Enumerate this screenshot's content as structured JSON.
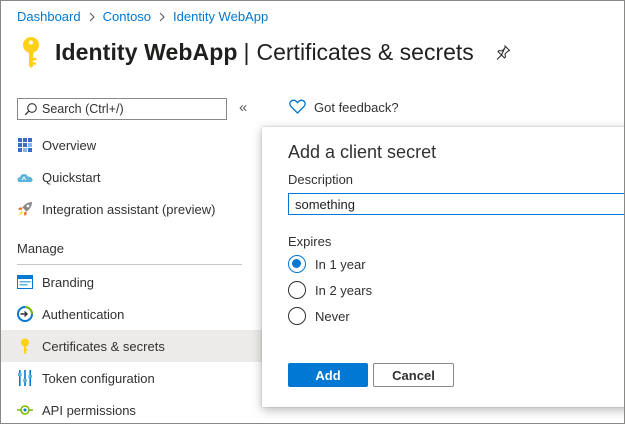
{
  "breadcrumb": {
    "items": [
      "Dashboard",
      "Contoso",
      "Identity WebApp"
    ]
  },
  "header": {
    "app_name": "Identity WebApp",
    "divider": "|",
    "page_name": "Certificates & secrets"
  },
  "search": {
    "placeholder": "Search (Ctrl+/)"
  },
  "sidebar": {
    "collapse_glyph": "«",
    "items": [
      {
        "label": "Overview",
        "icon": "overview-grid-icon"
      },
      {
        "label": "Quickstart",
        "icon": "quickstart-cloud-icon"
      },
      {
        "label": "Integration assistant (preview)",
        "icon": "rocket-icon"
      }
    ],
    "manage_heading": "Manage",
    "manage_items": [
      {
        "label": "Branding",
        "icon": "branding-icon"
      },
      {
        "label": "Authentication",
        "icon": "authentication-icon"
      },
      {
        "label": "Certificates & secrets",
        "icon": "key-icon",
        "active": true
      },
      {
        "label": "Token configuration",
        "icon": "token-config-icon"
      },
      {
        "label": "API permissions",
        "icon": "api-permissions-icon"
      }
    ]
  },
  "feedback": {
    "label": "Got feedback?"
  },
  "dialog": {
    "title": "Add a client secret",
    "description_label": "Description",
    "description_value": "something",
    "expires_label": "Expires",
    "expires_options": [
      {
        "label": "In 1 year",
        "checked": true
      },
      {
        "label": "In 2 years",
        "checked": false
      },
      {
        "label": "Never",
        "checked": false
      }
    ],
    "add_label": "Add",
    "cancel_label": "Cancel"
  },
  "colors": {
    "accent": "#0078d4",
    "key_yellow": "#fcd116",
    "active_nav": "#edebe9"
  }
}
